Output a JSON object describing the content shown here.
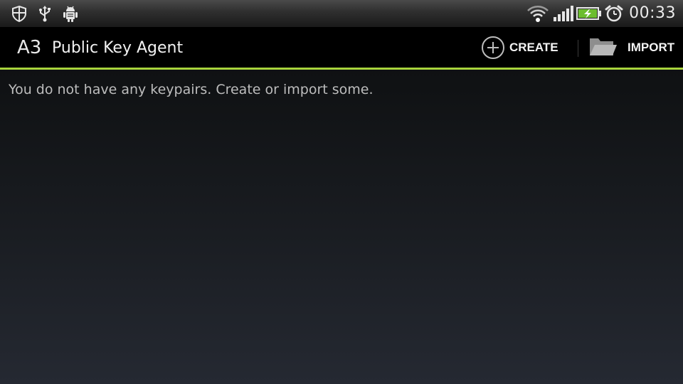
{
  "status_bar": {
    "left_icons": [
      "shield-icon",
      "usb-icon",
      "android-debug-icon"
    ],
    "right_icons": [
      "wifi-icon",
      "signal-icon",
      "battery-charging-icon",
      "alarm-clock-icon"
    ],
    "time": "00:33"
  },
  "action_bar": {
    "logo_text": "A3",
    "title": "Public Key Agent",
    "accent_color": "#a8d43c",
    "actions": {
      "create": {
        "label": "CREATE",
        "icon": "add-circle-icon"
      },
      "import": {
        "label": "IMPORT",
        "icon": "folder-open-icon"
      }
    }
  },
  "main": {
    "empty_message": "You do not have any keypairs. Create or import some."
  }
}
